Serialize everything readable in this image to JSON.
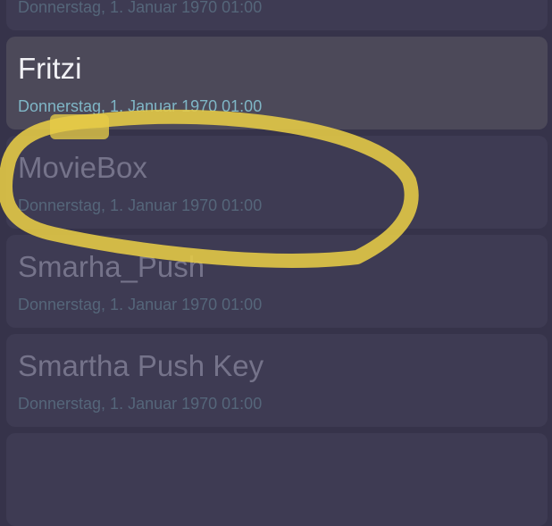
{
  "devices": [
    {
      "name": "",
      "date": "Donnerstag, 1. Januar 1970 01:00"
    },
    {
      "name": "Fritzi",
      "date": "Donnerstag, 1. Januar 1970 01:00"
    },
    {
      "name": "MovieBox",
      "date": "Donnerstag, 1. Januar 1970 01:00"
    },
    {
      "name": "Smarha_Push",
      "date": "Donnerstag, 1. Januar 1970 01:00"
    },
    {
      "name": "Smartha Push Key",
      "date": "Donnerstag, 1. Januar 1970 01:00"
    }
  ],
  "colors": {
    "background": "#36334a",
    "card": "#3e3b53",
    "card_selected": "#4c4959",
    "highlight_marker": "#e7cc46"
  }
}
